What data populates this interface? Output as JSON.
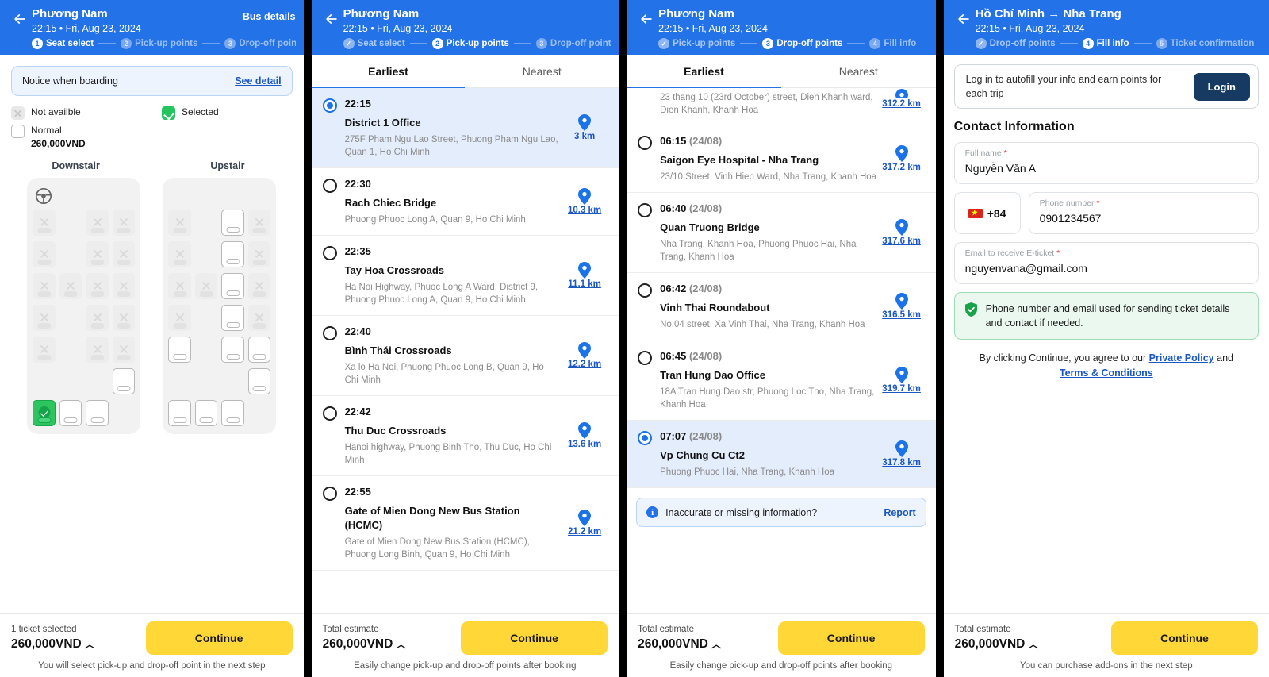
{
  "colors": {
    "header_blue": "#2372e8",
    "accent_yellow": "#ffd838",
    "link_blue": "#1a57c4",
    "selected_row": "#e4edfc",
    "green": "#22c55e",
    "login_navy": "#173a63"
  },
  "panel1": {
    "header": {
      "back_icon": "back-arrow-icon",
      "title": "Phương Nam",
      "subtitle": "22:15 • Fri, Aug 23, 2024",
      "action_label": "Bus details",
      "steps": [
        {
          "num": "1",
          "label": "Seat select",
          "state": "active"
        },
        {
          "num": "2",
          "label": "Pick-up points",
          "state": "todo"
        },
        {
          "num": "3",
          "label": "Drop-off points",
          "state": "todo"
        }
      ]
    },
    "notice": {
      "text": "Notice when boarding",
      "link": "See detail"
    },
    "legend": [
      {
        "state": "na",
        "label": "Not availble"
      },
      {
        "state": "sel",
        "label": "Selected"
      },
      {
        "state": "norm",
        "label": "Normal",
        "price": "260,000VND"
      }
    ],
    "decks": [
      {
        "label": "Downstair",
        "has_wheel": true,
        "rows": [
          [
            "na",
            "empty",
            "na",
            "na"
          ],
          [
            "na",
            "empty",
            "na",
            "na"
          ],
          [
            "na",
            "na",
            "na",
            "na"
          ],
          [
            "na",
            "empty",
            "na",
            "na"
          ],
          [
            "na",
            "empty",
            "na",
            "na"
          ],
          [
            "empty",
            "empty",
            "empty",
            "free"
          ],
          [
            "sel",
            "free",
            "free",
            "empty"
          ]
        ]
      },
      {
        "label": "Upstair",
        "has_wheel": false,
        "rows": [
          [
            "na",
            "empty",
            "free",
            "na"
          ],
          [
            "na",
            "empty",
            "free",
            "na"
          ],
          [
            "na",
            "na",
            "free",
            "na"
          ],
          [
            "na",
            "empty",
            "free",
            "na"
          ],
          [
            "free",
            "empty",
            "free",
            "free"
          ],
          [
            "empty",
            "empty",
            "empty",
            "free"
          ],
          [
            "free",
            "free",
            "free",
            "empty"
          ]
        ]
      }
    ],
    "footer": {
      "label": "1 ticket selected",
      "price": "260,000VND",
      "caret": "︿",
      "button": "Continue",
      "note": "You will select pick-up and drop-off point in the next step"
    }
  },
  "panel2": {
    "header": {
      "back_icon": "back-arrow-icon",
      "title": "Phương Nam",
      "subtitle": "22:15 • Fri, Aug 23, 2024",
      "steps": [
        {
          "num": "✓",
          "label": "Seat select",
          "state": "done"
        },
        {
          "num": "2",
          "label": "Pick-up points",
          "state": "active"
        },
        {
          "num": "3",
          "label": "Drop-off points",
          "state": "todo"
        }
      ]
    },
    "tabs": [
      {
        "label": "Earliest",
        "active": true
      },
      {
        "label": "Nearest",
        "active": false
      }
    ],
    "points": [
      {
        "time": "22:15",
        "day": "",
        "name": "District 1 Office",
        "address": "275F Pham Ngu Lao Street, Phuong Pham Ngu Lao, Quan 1, Ho Chi Minh",
        "distance": "3 km",
        "selected": true
      },
      {
        "time": "22:30",
        "day": "",
        "name": "Rach Chiec Bridge",
        "address": "Phuong Phuoc Long A, Quan 9, Ho Chi Minh",
        "distance": "10.3 km",
        "selected": false
      },
      {
        "time": "22:35",
        "day": "",
        "name": "Tay Hoa Crossroads",
        "address": "Ha Noi Highway, Phuoc Long A Ward, District 9, Phuong Phuoc Long A, Quan 9, Ho Chi Minh",
        "distance": "11.1 km",
        "selected": false
      },
      {
        "time": "22:40",
        "day": "",
        "name": "Bình Thái Crossroads",
        "address": "Xa lo Ha Noi, Phuong Phuoc Long B, Quan 9, Ho Chi Minh",
        "distance": "12.2 km",
        "selected": false
      },
      {
        "time": "22:42",
        "day": "",
        "name": "Thu Duc Crossroads",
        "address": "Hanoi highway, Phuong Binh Tho, Thu Duc, Ho Chi Minh",
        "distance": "13.6 km",
        "selected": false
      },
      {
        "time": "22:55",
        "day": "",
        "name": "Gate of Mien Dong New Bus Station (HCMC)",
        "address": "Gate of Mien Dong New Bus Station (HCMC), Phuong Long Binh, Quan 9, Ho Chi Minh",
        "distance": "21.2 km",
        "selected": false
      }
    ],
    "footer": {
      "label": "Total estimate",
      "price": "260,000VND",
      "caret": "︿",
      "button": "Continue",
      "note": "Easily change pick-up and drop-off points after booking"
    }
  },
  "panel3": {
    "header": {
      "back_icon": "back-arrow-icon",
      "title": "Phương Nam",
      "subtitle": "22:15 • Fri, Aug 23, 2024",
      "steps": [
        {
          "num": "✓",
          "label": "Pick-up points",
          "state": "done"
        },
        {
          "num": "3",
          "label": "Drop-off points",
          "state": "active"
        },
        {
          "num": "4",
          "label": "Fill info",
          "state": "todo"
        }
      ]
    },
    "tabs": [
      {
        "label": "Earliest",
        "active": true
      },
      {
        "label": "Nearest",
        "active": false
      }
    ],
    "partial_item": {
      "address": "23 thang 10 (23rd October) street, Dien Khanh ward, Dien Khanh, Khanh Hoa",
      "distance": "312.2 km"
    },
    "points": [
      {
        "time": "06:15",
        "day": "(24/08)",
        "name": "Saigon Eye Hospital - Nha Trang",
        "address": "23/10 Street, Vinh Hiep Ward, Nha Trang, Khanh Hoa",
        "distance": "317.2 km",
        "selected": false
      },
      {
        "time": "06:40",
        "day": "(24/08)",
        "name": "Quan Truong Bridge",
        "address": "Nha Trang, Khanh Hoa, Phuong Phuoc Hai, Nha Trang, Khanh Hoa",
        "distance": "317.6 km",
        "selected": false
      },
      {
        "time": "06:42",
        "day": "(24/08)",
        "name": "Vinh Thai Roundabout",
        "address": "No.04 street, Xa Vinh Thai, Nha Trang, Khanh Hoa",
        "distance": "316.5 km",
        "selected": false
      },
      {
        "time": "06:45",
        "day": "(24/08)",
        "name": "Tran Hung Dao Office",
        "address": "18A Tran Hung Dao str, Phuong Loc Tho, Nha Trang, Khanh Hoa",
        "distance": "319.7 km",
        "selected": false
      },
      {
        "time": "07:07",
        "day": "(24/08)",
        "name": "Vp Chung Cu Ct2",
        "address": "Phuong Phuoc Hai, Nha Trang, Khanh Hoa",
        "distance": "317.8 km",
        "selected": true
      }
    ],
    "report": {
      "icon": "info-icon",
      "text": "Inaccurate or missing information?",
      "link": "Report"
    },
    "footer": {
      "label": "Total estimate",
      "price": "260,000VND",
      "caret": "︿",
      "button": "Continue",
      "note": "Easily change pick-up and drop-off points after booking"
    }
  },
  "panel4": {
    "header": {
      "back_icon": "back-arrow-icon",
      "title": "Hồ Chí Minh → Nha Trang",
      "subtitle": "22:15 • Fri, Aug 23, 2024",
      "steps": [
        {
          "num": "✓",
          "label": "Drop-off points",
          "state": "done"
        },
        {
          "num": "4",
          "label": "Fill info",
          "state": "active"
        },
        {
          "num": "5",
          "label": "Ticket confirmation",
          "state": "todo"
        }
      ]
    },
    "login_banner": {
      "text": "Log in to autofill your info and earn points for each trip",
      "button": "Login"
    },
    "section_title": "Contact Information",
    "fields": {
      "full_name": {
        "label": "Full name",
        "required": "*",
        "value": "Nguyễn Văn A"
      },
      "country_code": {
        "value": "+84",
        "flag": "vietnam-flag-icon"
      },
      "phone": {
        "label": "Phone number",
        "required": "*",
        "value": "0901234567"
      },
      "email": {
        "label": "Email to receive E-ticket",
        "required": "*",
        "value": "nguyenvana@gmail.com"
      }
    },
    "notice_green": {
      "icon": "shield-check-icon",
      "text": "Phone number and email used for sending ticket details and contact if needed."
    },
    "terms": {
      "prefix": "By clicking Continue, you agree to our ",
      "link1": "Private Policy",
      "middle": " and",
      "link2": "Terms & Conditions"
    },
    "footer": {
      "label": "Total estimate",
      "price": "260,000VND",
      "caret": "︿",
      "button": "Continue",
      "note": "You can purchase add-ons in the next step"
    }
  }
}
